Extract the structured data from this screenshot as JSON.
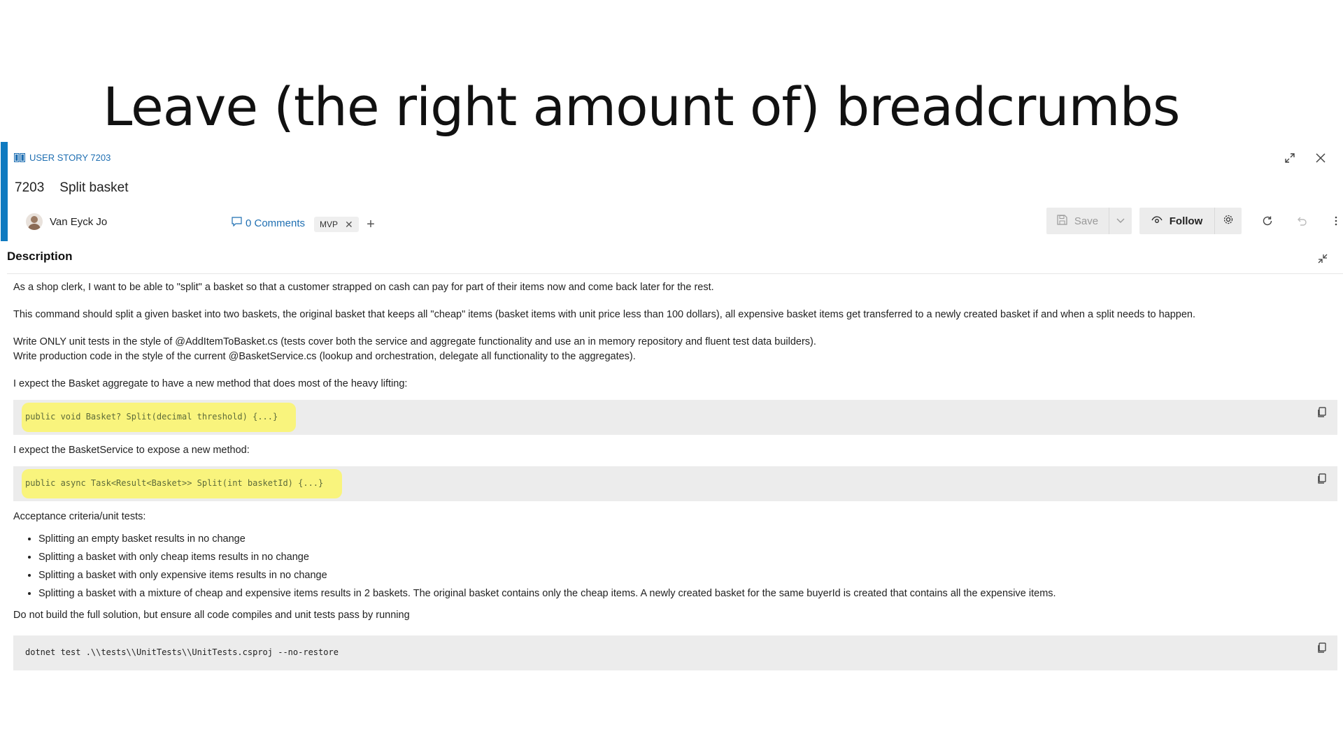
{
  "slide": {
    "title": "Leave (the right amount of) breadcrumbs"
  },
  "work_item": {
    "type_label": "USER STORY 7203",
    "id": "7203",
    "title": "Split basket",
    "assignee": "Van Eyck Jo",
    "comments_label": "0 Comments",
    "tag": "MVP"
  },
  "toolbar": {
    "save_label": "Save",
    "follow_label": "Follow"
  },
  "description": {
    "heading": "Description",
    "p1": "As a shop clerk, I want to be able to \"split\" a basket so that a customer strapped on cash can pay for part of their items now and come back later for the rest.",
    "p2": "This command should split a given basket into two baskets, the original basket that keeps all \"cheap\" items (basket items with unit price less than 100 dollars), all expensive basket items get transferred to a newly created basket if and when a split needs to happen.",
    "p3a": "Write ONLY unit tests in the style of @AddItemToBasket.cs (tests cover both the service and aggregate functionality and use an in memory repository and fluent test data builders).",
    "p3b": "Write production code in the style of the current @BasketService.cs (lookup and orchestration, delegate all functionality to the aggregates).",
    "p4": "I expect the Basket aggregate to have a new method that does most of the heavy lifting:",
    "code1": "public void Basket? Split(decimal threshold) {...}",
    "p5": "I expect the BasketService to expose a new method:",
    "code2": "public async Task<Result<Basket>> Split(int basketId) {...}",
    "p6": "Acceptance criteria/unit tests:",
    "criteria": [
      "Splitting an empty basket results in no change",
      "Splitting a basket with only cheap items results in no change",
      "Splitting a basket with only expensive items results in no change",
      "Splitting a basket with a mixture of cheap and expensive items results in 2 baskets. The original basket contains only the cheap items. A newly created basket for the same buyerId is created that contains all the expensive items."
    ],
    "p7": "Do not build the full solution, but ensure all code compiles and unit tests pass by running",
    "code3": "dotnet test .\\\\tests\\\\UnitTests\\\\UnitTests.csproj --no-restore"
  },
  "colors": {
    "accent": "#0f7ac0",
    "link": "#1f6fb2",
    "highlight": "#fbf66a",
    "code_bg": "#ececec"
  },
  "icons": [
    "book-icon",
    "expand-icon",
    "close-icon",
    "avatar",
    "comment-icon",
    "tag-remove-icon",
    "add-tag-icon",
    "save-icon",
    "chevron-down-icon",
    "eye-icon",
    "gear-icon",
    "refresh-icon",
    "undo-icon",
    "more-icon",
    "collapse-icon",
    "copy-icon"
  ]
}
